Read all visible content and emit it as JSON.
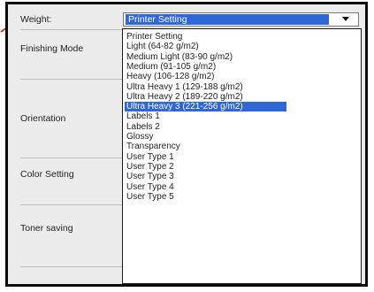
{
  "colors": {
    "accent": "#2f67d6",
    "arrow": "#cc2a2a"
  },
  "labels": {
    "weight": "Weight:",
    "finishing_mode": "Finishing Mode",
    "orientation": "Orientation",
    "color_setting": "Color Setting",
    "toner_saving": "Toner saving"
  },
  "weight": {
    "selected_value": "Printer Setting",
    "options": [
      "Printer Setting",
      "Light (64-82 g/m2)",
      "Medium Light (83-90 g/m2)",
      "Medium (91-105 g/m2)",
      "Heavy (106-128 g/m2)",
      "Ultra Heavy 1 (129-188 g/m2)",
      "Ultra Heavy 2 (189-220 g/m2)",
      "Ultra Heavy 3 (221-256 g/m2)",
      "Labels 1",
      "Labels 2",
      "Glossy",
      "Transparency",
      "User Type 1",
      "User Type 2",
      "User Type 3",
      "User Type 4",
      "User Type 5"
    ],
    "highlighted_index": 7
  },
  "icons": {
    "pointer": "arrow-icon",
    "dropdown": "chevron-down-icon"
  }
}
